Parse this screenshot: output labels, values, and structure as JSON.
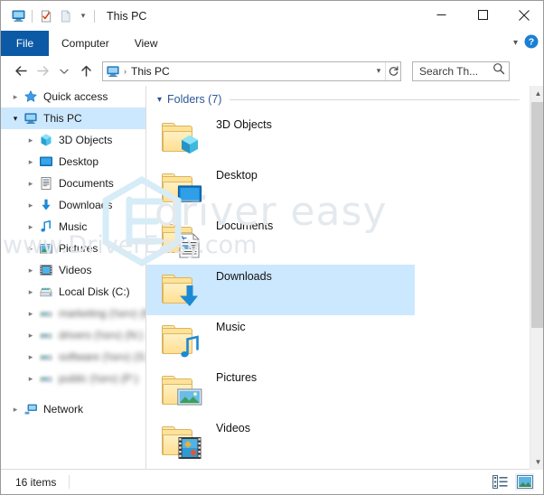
{
  "window": {
    "title": "This PC",
    "quick_access_toolbar": [
      {
        "name": "this-pc-icon",
        "label": "This PC"
      },
      {
        "name": "properties-icon",
        "label": "Properties"
      },
      {
        "name": "new-folder-icon",
        "label": "New folder"
      }
    ],
    "qat_dropdown": "Customize Quick Access Toolbar",
    "controls": {
      "minimize": "Minimize",
      "maximize": "Maximize",
      "close": "Close"
    }
  },
  "ribbon": {
    "file_tab": "File",
    "tabs": [
      {
        "label": "Computer"
      },
      {
        "label": "View"
      }
    ],
    "collapse_label": "Minimize the Ribbon",
    "help_label": "?"
  },
  "addressbar": {
    "back_label": "Back",
    "forward_label": "Forward",
    "recent_label": "Recent locations",
    "up_label": "Up",
    "path_icon": "this-pc-icon",
    "path_separator": "›",
    "path_text": "This PC",
    "dropdown_label": "Previous locations",
    "refresh_label": "Refresh"
  },
  "search": {
    "placeholder": "Search Th...",
    "icon": "search-icon"
  },
  "navpane": {
    "items": [
      {
        "label": "Quick access",
        "icon": "star-icon",
        "indent": 1,
        "expander": "collapsed",
        "selected": false,
        "blurred": false
      },
      {
        "label": "This PC",
        "icon": "this-pc-icon",
        "indent": 1,
        "expander": "expanded",
        "selected": true,
        "blurred": false
      },
      {
        "label": "3D Objects",
        "icon": "3d-objects-icon",
        "indent": 2,
        "expander": "collapsed",
        "selected": false,
        "blurred": false
      },
      {
        "label": "Desktop",
        "icon": "desktop-icon",
        "indent": 2,
        "expander": "collapsed",
        "selected": false,
        "blurred": false
      },
      {
        "label": "Documents",
        "icon": "documents-icon",
        "indent": 2,
        "expander": "collapsed",
        "selected": false,
        "blurred": false
      },
      {
        "label": "Downloads",
        "icon": "downloads-icon",
        "indent": 2,
        "expander": "collapsed",
        "selected": false,
        "blurred": false
      },
      {
        "label": "Music",
        "icon": "music-icon",
        "indent": 2,
        "expander": "collapsed",
        "selected": false,
        "blurred": false
      },
      {
        "label": "Pictures",
        "icon": "pictures-icon",
        "indent": 2,
        "expander": "collapsed",
        "selected": false,
        "blurred": false
      },
      {
        "label": "Videos",
        "icon": "videos-icon",
        "indent": 2,
        "expander": "collapsed",
        "selected": false,
        "blurred": false
      },
      {
        "label": "Local Disk (C:)",
        "icon": "drive-icon",
        "indent": 2,
        "expander": "collapsed",
        "selected": false,
        "blurred": false
      },
      {
        "label": "marketing (\\\\srv) (M:)",
        "icon": "network-drive-icon",
        "indent": 2,
        "expander": "collapsed",
        "selected": false,
        "blurred": true
      },
      {
        "label": "drivers (\\\\srv) (N:)",
        "icon": "network-drive-icon",
        "indent": 2,
        "expander": "collapsed",
        "selected": false,
        "blurred": true
      },
      {
        "label": "software (\\\\srv) (S:)",
        "icon": "network-drive-icon",
        "indent": 2,
        "expander": "collapsed",
        "selected": false,
        "blurred": true
      },
      {
        "label": "public (\\\\srv) (P:)",
        "icon": "network-drive-icon",
        "indent": 2,
        "expander": "collapsed",
        "selected": false,
        "blurred": true
      },
      {
        "label": "Network",
        "icon": "network-icon",
        "indent": 1,
        "expander": "collapsed",
        "selected": false,
        "blurred": false
      }
    ]
  },
  "filelist": {
    "group_label": "Folders (7)",
    "group_state": "expanded",
    "items": [
      {
        "name": "3D Objects",
        "icon": "folder-3d-objects-icon",
        "selected": false
      },
      {
        "name": "Desktop",
        "icon": "folder-desktop-icon",
        "selected": false
      },
      {
        "name": "Documents",
        "icon": "folder-documents-icon",
        "selected": false
      },
      {
        "name": "Downloads",
        "icon": "folder-downloads-icon",
        "selected": true
      },
      {
        "name": "Music",
        "icon": "folder-music-icon",
        "selected": false
      },
      {
        "name": "Pictures",
        "icon": "folder-pictures-icon",
        "selected": false
      },
      {
        "name": "Videos",
        "icon": "folder-videos-icon",
        "selected": false
      }
    ]
  },
  "statusbar": {
    "item_count": "16 items",
    "views": [
      {
        "name": "details-view-button",
        "label": "Details view",
        "active": false
      },
      {
        "name": "large-icons-view-button",
        "label": "Large icons view",
        "active": true
      }
    ]
  },
  "watermark": {
    "line1": "driver easy",
    "line2": "www.DriverEasy.com",
    "logo": "driver-easy-hex-logo"
  },
  "colors": {
    "file_tab_blue": "#0c5aa6",
    "selection_blue": "#cce8ff",
    "group_header_blue": "#2b5797",
    "help_blue": "#1a7fd4",
    "folder_yellow": "#ffdf92",
    "watermark_gray": "#e4e9ee"
  }
}
